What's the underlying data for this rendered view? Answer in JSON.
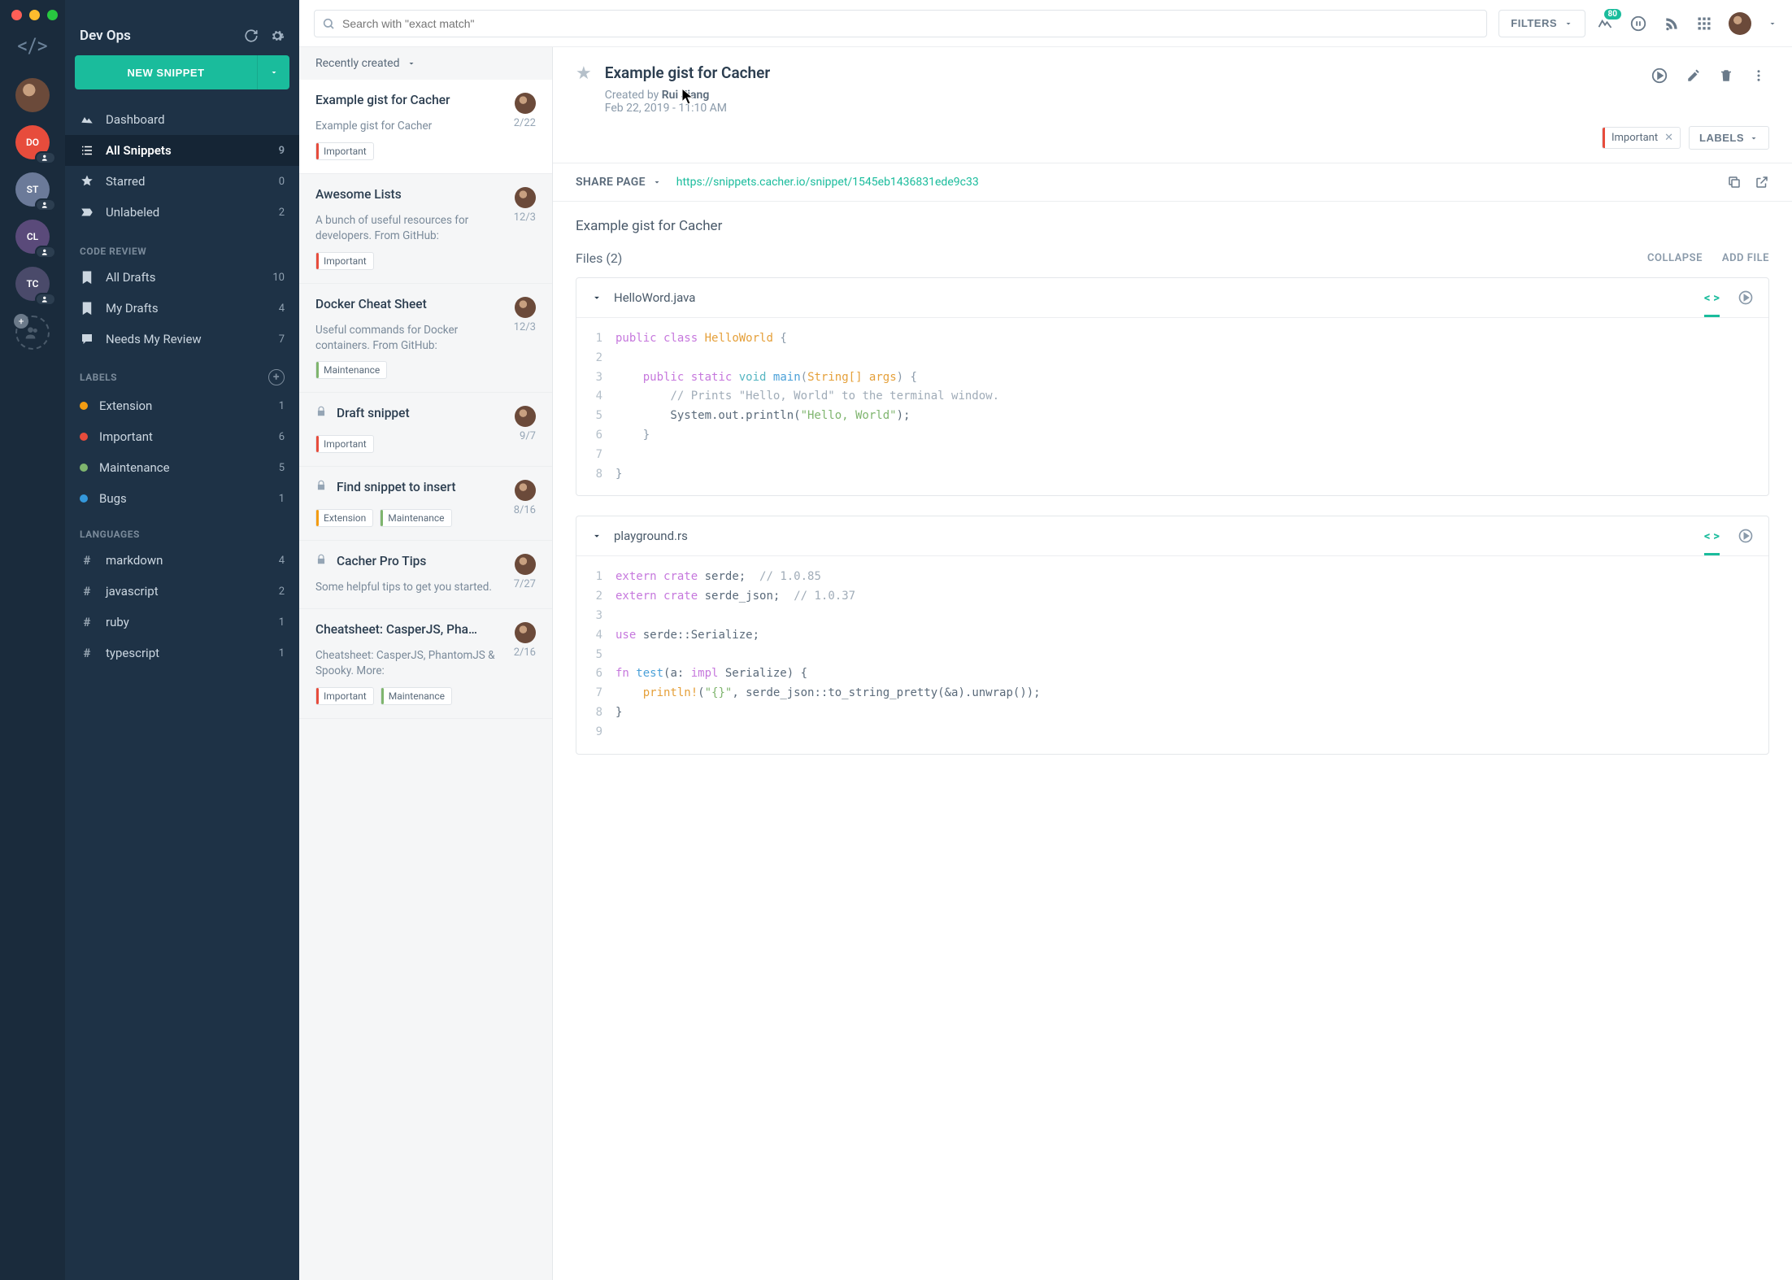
{
  "window": {
    "title": "Dev Ops"
  },
  "rail": {
    "badge_notif": "80",
    "teams": [
      {
        "id": "user",
        "type": "img"
      },
      {
        "id": "do",
        "label": "DO",
        "cls": "do"
      },
      {
        "id": "st",
        "label": "ST",
        "cls": "st"
      },
      {
        "id": "cl",
        "label": "CL",
        "cls": "cl"
      },
      {
        "id": "tc",
        "label": "TC",
        "cls": "tc"
      }
    ]
  },
  "sidebar": {
    "title": "Dev Ops",
    "new_snippet": "NEW SNIPPET",
    "nav": [
      {
        "icon": "chart",
        "label": "Dashboard"
      },
      {
        "icon": "list",
        "label": "All Snippets",
        "count": "9",
        "active": true
      },
      {
        "icon": "star",
        "label": "Starred",
        "count": "0"
      },
      {
        "icon": "tag",
        "label": "Unlabeled",
        "count": "2"
      }
    ],
    "section_review": "CODE REVIEW",
    "review": [
      {
        "icon": "bookmark",
        "label": "All Drafts",
        "count": "10"
      },
      {
        "icon": "bookmark",
        "label": "My Drafts",
        "count": "4"
      },
      {
        "icon": "review",
        "label": "Needs My Review",
        "count": "7"
      }
    ],
    "section_labels": "LABELS",
    "labels": [
      {
        "color": "#f39c12",
        "label": "Extension",
        "count": "1"
      },
      {
        "color": "#e74c3c",
        "label": "Important",
        "count": "6"
      },
      {
        "color": "#7fb56e",
        "label": "Maintenance",
        "count": "5"
      },
      {
        "color": "#3498db",
        "label": "Bugs",
        "count": "1"
      }
    ],
    "section_languages": "LANGUAGES",
    "languages": [
      {
        "label": "markdown",
        "count": "4"
      },
      {
        "label": "javascript",
        "count": "2"
      },
      {
        "label": "ruby",
        "count": "1"
      },
      {
        "label": "typescript",
        "count": "1"
      }
    ]
  },
  "topbar": {
    "search_placeholder": "Search with \"exact match\"",
    "filters": "FILTERS",
    "notif_badge": "80"
  },
  "list": {
    "sort": "Recently created",
    "items": [
      {
        "title": "Example gist for Cacher",
        "desc": "Example gist for Cacher",
        "date": "2/22",
        "tags": [
          {
            "label": "Important",
            "color": "#e74c3c"
          }
        ],
        "selected": true
      },
      {
        "title": "Awesome Lists",
        "desc": "A bunch of useful resources for developers. From GitHub:",
        "date": "12/3",
        "tags": [
          {
            "label": "Important",
            "color": "#e74c3c"
          }
        ]
      },
      {
        "title": "Docker Cheat Sheet",
        "desc": "Useful commands for Docker containers. From GitHub:",
        "date": "12/3",
        "tags": [
          {
            "label": "Maintenance",
            "color": "#7fb56e"
          }
        ]
      },
      {
        "title": "Draft snippet",
        "desc": "",
        "date": "9/7",
        "tags": [
          {
            "label": "Important",
            "color": "#e74c3c"
          }
        ],
        "locked": true
      },
      {
        "title": "Find snippet to insert",
        "desc": "",
        "date": "8/16",
        "tags": [
          {
            "label": "Extension",
            "color": "#f39c12"
          },
          {
            "label": "Maintenance",
            "color": "#7fb56e"
          }
        ],
        "locked": true
      },
      {
        "title": "Cacher Pro Tips",
        "desc": "Some helpful tips to get you started.",
        "date": "7/27",
        "tags": [],
        "locked": true
      },
      {
        "title": "Cheatsheet: CasperJS, Pha…",
        "desc": "Cheatsheet: CasperJS, PhantomJS & Spooky. More:",
        "date": "2/16",
        "tags": [
          {
            "label": "Important",
            "color": "#e74c3c"
          },
          {
            "label": "Maintenance",
            "color": "#7fb56e"
          }
        ]
      }
    ]
  },
  "detail": {
    "title": "Example gist for Cacher",
    "created_by_label": "Created by ",
    "author": "Rui Jiang",
    "timestamp": "Feb 22, 2019 - 11:10 AM",
    "chip": {
      "label": "Important",
      "color": "#e74c3c"
    },
    "labels_btn": "LABELS",
    "share_label": "SHARE PAGE",
    "share_url": "https://snippets.cacher.io/snippet/1545eb1436831ede9c33",
    "desc": "Example gist for Cacher",
    "files_label": "Files (2)",
    "collapse": "COLLAPSE",
    "add_file": "ADD FILE",
    "files": [
      {
        "name": "HelloWord.java",
        "lines": [
          {
            "n": "1",
            "html": "<span class='kw'>public</span> <span class='kw'>class</span> <span class='cls'>HelloWorld</span> <span class='punc'>{</span>"
          },
          {
            "n": "2",
            "html": ""
          },
          {
            "n": "3",
            "html": "    <span class='kw'>public</span> <span class='kw'>static</span> <span class='kw2'>void</span> <span class='fn'>main</span><span class='punc'>(</span><span class='type'>String[] args</span><span class='punc'>)</span> <span class='punc'>{</span>"
          },
          {
            "n": "4",
            "html": "        <span class='cmt'>// Prints \"Hello, World\" to the terminal window.</span>"
          },
          {
            "n": "5",
            "html": "        System.out.println(<span class='str'>\"Hello, World\"</span>);"
          },
          {
            "n": "6",
            "html": "    <span class='punc'>}</span>"
          },
          {
            "n": "7",
            "html": ""
          },
          {
            "n": "8",
            "html": "<span class='punc'>}</span>"
          }
        ]
      },
      {
        "name": "playground.rs",
        "lines": [
          {
            "n": "1",
            "html": "<span class='kw'>extern</span> <span class='kw'>crate</span> serde;  <span class='cmt'>// 1.0.85</span>"
          },
          {
            "n": "2",
            "html": "<span class='kw'>extern</span> <span class='kw'>crate</span> serde_json;  <span class='cmt'>// 1.0.37</span>"
          },
          {
            "n": "3",
            "html": ""
          },
          {
            "n": "4",
            "html": "<span class='kw'>use</span> serde::Serialize;"
          },
          {
            "n": "5",
            "html": ""
          },
          {
            "n": "6",
            "html": "<span class='kw'>fn</span> <span class='fn'>test</span>(a: <span class='kw'>impl</span> Serialize) {"
          },
          {
            "n": "7",
            "html": "    <span class='cls'>println!</span>(<span class='str'>\"{}\"</span>, serde_json::to_string_pretty(&a).unwrap());"
          },
          {
            "n": "8",
            "html": "}"
          },
          {
            "n": "9",
            "html": ""
          }
        ]
      }
    ]
  }
}
